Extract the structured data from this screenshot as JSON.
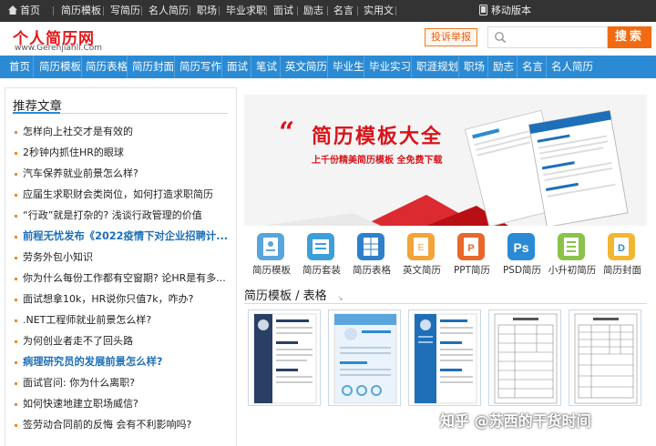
{
  "topbar": {
    "items": [
      "首页",
      "简历模板",
      "写简历",
      "名人简历",
      "职场",
      "毕业求职",
      "面试",
      "励志",
      "名言",
      "实用文"
    ],
    "mobile": "移动版本"
  },
  "header": {
    "logo_cn": "个人简历网",
    "logo_en": "www.Gerenjianli.Com",
    "report_btn": "投诉举报",
    "search_placeholder": "",
    "search_btn": "搜索"
  },
  "nav": [
    "首页",
    "简历模板",
    "简历表格",
    "简历封面",
    "简历写作",
    "面试",
    "笔试",
    "英文简历",
    "毕业生",
    "毕业实习",
    "职涯规划",
    "职场",
    "励志",
    "名言",
    "名人简历"
  ],
  "left": {
    "title": "推荐文章",
    "articles": [
      {
        "text": "怎样向上社交才是有效的",
        "hl": false
      },
      {
        "text": "2秒钟内抓住HR的眼球",
        "hl": false
      },
      {
        "text": "汽车保养就业前景怎么样?",
        "hl": false
      },
      {
        "text": "应届生求职财会类岗位，如何打造求职简历",
        "hl": false
      },
      {
        "text": "“行政”就是打杂的? 浅谈行政管理的价值",
        "hl": false
      },
      {
        "text": "前程无忧发布《2022疫情下对企业招聘计...",
        "hl": true
      },
      {
        "text": "劳务外包小知识",
        "hl": false
      },
      {
        "text": "你为什么每份工作都有空窗期? 论HR是有多...",
        "hl": false
      },
      {
        "text": "面试想拿10k，HR说你只值7k，咋办?",
        "hl": false
      },
      {
        "text": ".NET工程师就业前景怎么样?",
        "hl": false
      },
      {
        "text": "为何创业者走不了回头路",
        "hl": false
      },
      {
        "text": "病理研究员的发展前景怎么样?",
        "hl": true
      },
      {
        "text": "面试官问: 你为什么离职?",
        "hl": false
      },
      {
        "text": "如何快速地建立职场威信?",
        "hl": false
      },
      {
        "text": "签劳动合同前的反悔 会有不利影响吗?",
        "hl": false
      }
    ]
  },
  "banner": {
    "quote": "“",
    "title": "简历模板大全",
    "subtitle": "上千份精美简历模板 全免费下载"
  },
  "categories": [
    {
      "label": "简历模板",
      "color": "#5aa5dc",
      "icon": "resume-template-icon"
    },
    {
      "label": "简历套装",
      "color": "#3c9fd9",
      "icon": "resume-set-icon"
    },
    {
      "label": "简历表格",
      "color": "#2f7fcb",
      "icon": "resume-table-icon"
    },
    {
      "label": "英文简历",
      "color": "#f2a33a",
      "icon": "english-resume-icon"
    },
    {
      "label": "PPT简历",
      "color": "#e8672a",
      "icon": "ppt-resume-icon"
    },
    {
      "label": "PSD简历",
      "color": "#2b8ad4",
      "icon": "psd-resume-icon"
    },
    {
      "label": "小升初简历",
      "color": "#8bc34a",
      "icon": "primary-resume-icon"
    },
    {
      "label": "简历封面",
      "color": "#f2b632",
      "icon": "resume-cover-icon"
    }
  ],
  "section": {
    "title": "简历模板 / 表格"
  },
  "watermark": "知乎 @苏西的干货时间"
}
